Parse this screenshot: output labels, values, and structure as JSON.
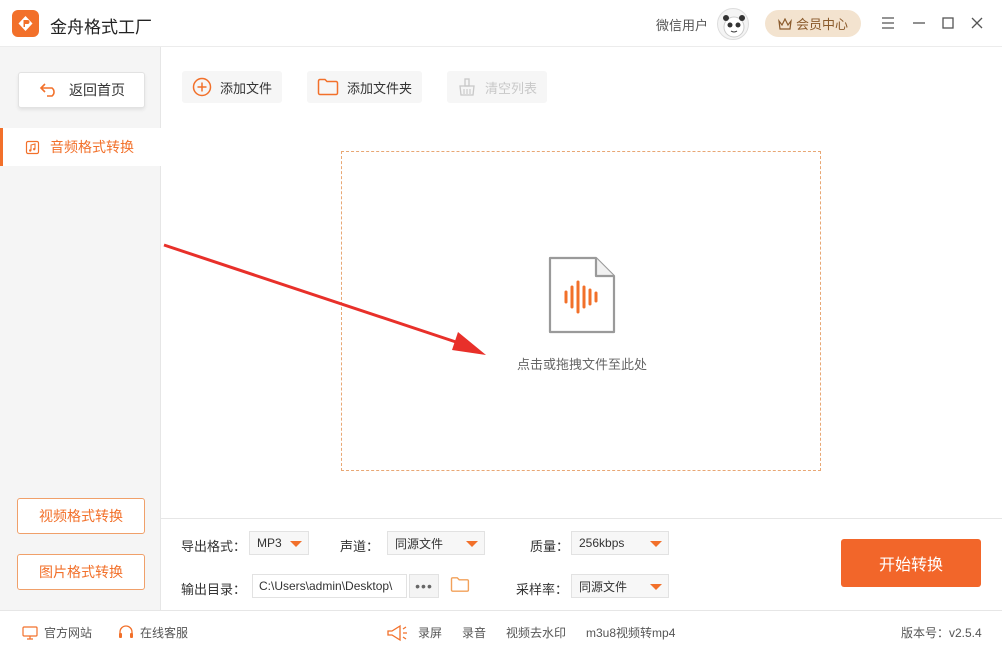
{
  "app": {
    "title": "金舟格式工厂"
  },
  "user": {
    "name": "微信用户",
    "vip_label": "会员中心"
  },
  "sidebar": {
    "back_label": "返回首页",
    "active_item": "音频格式转换",
    "video_btn": "视频格式转换",
    "image_btn": "图片格式转换"
  },
  "toolbar": {
    "add_file": "添加文件",
    "add_folder": "添加文件夹",
    "clear_list": "清空列表"
  },
  "dropzone": {
    "hint": "点击或拖拽文件至此处"
  },
  "settings": {
    "format_label": "导出格式：",
    "format_value": "MP3",
    "channel_label": "声道：",
    "channel_value": "同源文件",
    "quality_label": "质量：",
    "quality_value": "256kbps",
    "output_label": "输出目录：",
    "output_value": "C:\\Users\\admin\\Desktop\\",
    "dots": "•••",
    "sample_label": "采样率：",
    "sample_value": "同源文件"
  },
  "start_label": "开始转换",
  "statusbar": {
    "website": "官方网站",
    "service": "在线客服",
    "record_screen": "录屏",
    "record_audio": "录音",
    "watermark": "视频去水印",
    "m3u8": "m3u8视频转mp4",
    "version": "版本号：v2.5.4"
  },
  "colors": {
    "accent": "#f2702a",
    "arrow": "#e8302a",
    "vip_bg": "#f3e3cf"
  }
}
